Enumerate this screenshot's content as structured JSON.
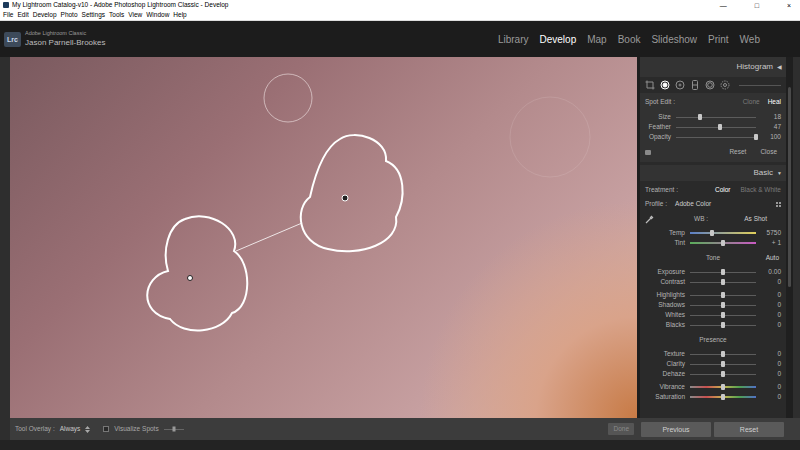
{
  "window": {
    "title": "My Lightroom Catalog-v10 - Adobe Photoshop Lightroom Classic - Develop",
    "controls": [
      "—",
      "□",
      "×"
    ]
  },
  "menu": [
    "File",
    "Edit",
    "Develop",
    "Photo",
    "Settings",
    "Tools",
    "View",
    "Window",
    "Help"
  ],
  "identity": {
    "logo": "Lrc",
    "product": "Adobe Lightroom Classic",
    "user": "Jason Parnell-Brookes"
  },
  "modules": [
    {
      "label": "Library",
      "selected": false
    },
    {
      "label": "Develop",
      "selected": true
    },
    {
      "label": "Map",
      "selected": false
    },
    {
      "label": "Book",
      "selected": false
    },
    {
      "label": "Slideshow",
      "selected": false
    },
    {
      "label": "Print",
      "selected": false
    },
    {
      "label": "Web",
      "selected": false
    }
  ],
  "histogram": {
    "title": "Histogram",
    "toggle": "◀"
  },
  "tools": [
    {
      "kind": "crop",
      "selected": false
    },
    {
      "kind": "spot",
      "selected": true
    },
    {
      "kind": "redeye",
      "selected": false
    },
    {
      "kind": "graduated",
      "selected": false
    },
    {
      "kind": "radial",
      "selected": false
    },
    {
      "kind": "brush",
      "selected": false
    }
  ],
  "spot_edit": {
    "label": "Spot Edit :",
    "modes": [
      {
        "label": "Clone",
        "selected": false
      },
      {
        "label": "Heal",
        "selected": true
      }
    ],
    "sliders": [
      {
        "label": "Size",
        "value": "18",
        "level": 0.3,
        "kind": "plain"
      },
      {
        "label": "Feather",
        "value": "47",
        "level": 0.55,
        "kind": "plain"
      },
      {
        "label": "Opacity",
        "value": "100",
        "level": 1,
        "kind": "plain"
      }
    ],
    "buttons": [
      "Reset",
      "Close"
    ]
  },
  "basic": {
    "title": "Basic",
    "toggle": "▼",
    "treatment": {
      "label": "Treatment :",
      "options": [
        {
          "label": "Color",
          "selected": true
        },
        {
          "label": "Black & White",
          "selected": false
        }
      ]
    },
    "profile": {
      "label": "Profile :",
      "value": "Adobe Color"
    },
    "wb": {
      "label": "WB :",
      "value": "As Shot"
    },
    "wb_sliders": [
      {
        "label": "Temp",
        "value": "5750",
        "level": 0.33,
        "kind": "temp"
      },
      {
        "label": "Tint",
        "value": "+ 1",
        "level": 0.5,
        "kind": "tint"
      }
    ],
    "groups": [
      {
        "title": "Tone",
        "action": "Auto",
        "rows": [
          [
            {
              "label": "Exposure",
              "value": "0.00",
              "level": 0.5,
              "kind": "plain"
            },
            {
              "label": "Contrast",
              "value": "0",
              "level": 0.5,
              "kind": "plain"
            }
          ],
          [
            {
              "label": "Highlights",
              "value": "0",
              "level": 0.5,
              "kind": "plain"
            },
            {
              "label": "Shadows",
              "value": "0",
              "level": 0.5,
              "kind": "plain"
            },
            {
              "label": "Whites",
              "value": "0",
              "level": 0.5,
              "kind": "plain"
            },
            {
              "label": "Blacks",
              "value": "0",
              "level": 0.5,
              "kind": "plain"
            }
          ]
        ]
      },
      {
        "title": "Presence",
        "action": "",
        "rows": [
          [
            {
              "label": "Texture",
              "value": "0",
              "level": 0.5,
              "kind": "plain"
            },
            {
              "label": "Clarity",
              "value": "0",
              "level": 0.5,
              "kind": "plain"
            },
            {
              "label": "Dehaze",
              "value": "0",
              "level": 0.5,
              "kind": "plain"
            }
          ],
          [
            {
              "label": "Vibrance",
              "value": "0",
              "level": 0.5,
              "kind": "color"
            },
            {
              "label": "Saturation",
              "value": "0",
              "level": 0.5,
              "kind": "color"
            }
          ]
        ]
      }
    ]
  },
  "toolbar": {
    "overlay_label": "Tool Overlay :",
    "overlay_value": "Always",
    "visualize": {
      "label": "Visualize Spots",
      "checked": false,
      "level": 0.5
    },
    "done": {
      "label": "Done",
      "disabled": true
    }
  },
  "footer_buttons": [
    "Previous",
    "Reset"
  ]
}
